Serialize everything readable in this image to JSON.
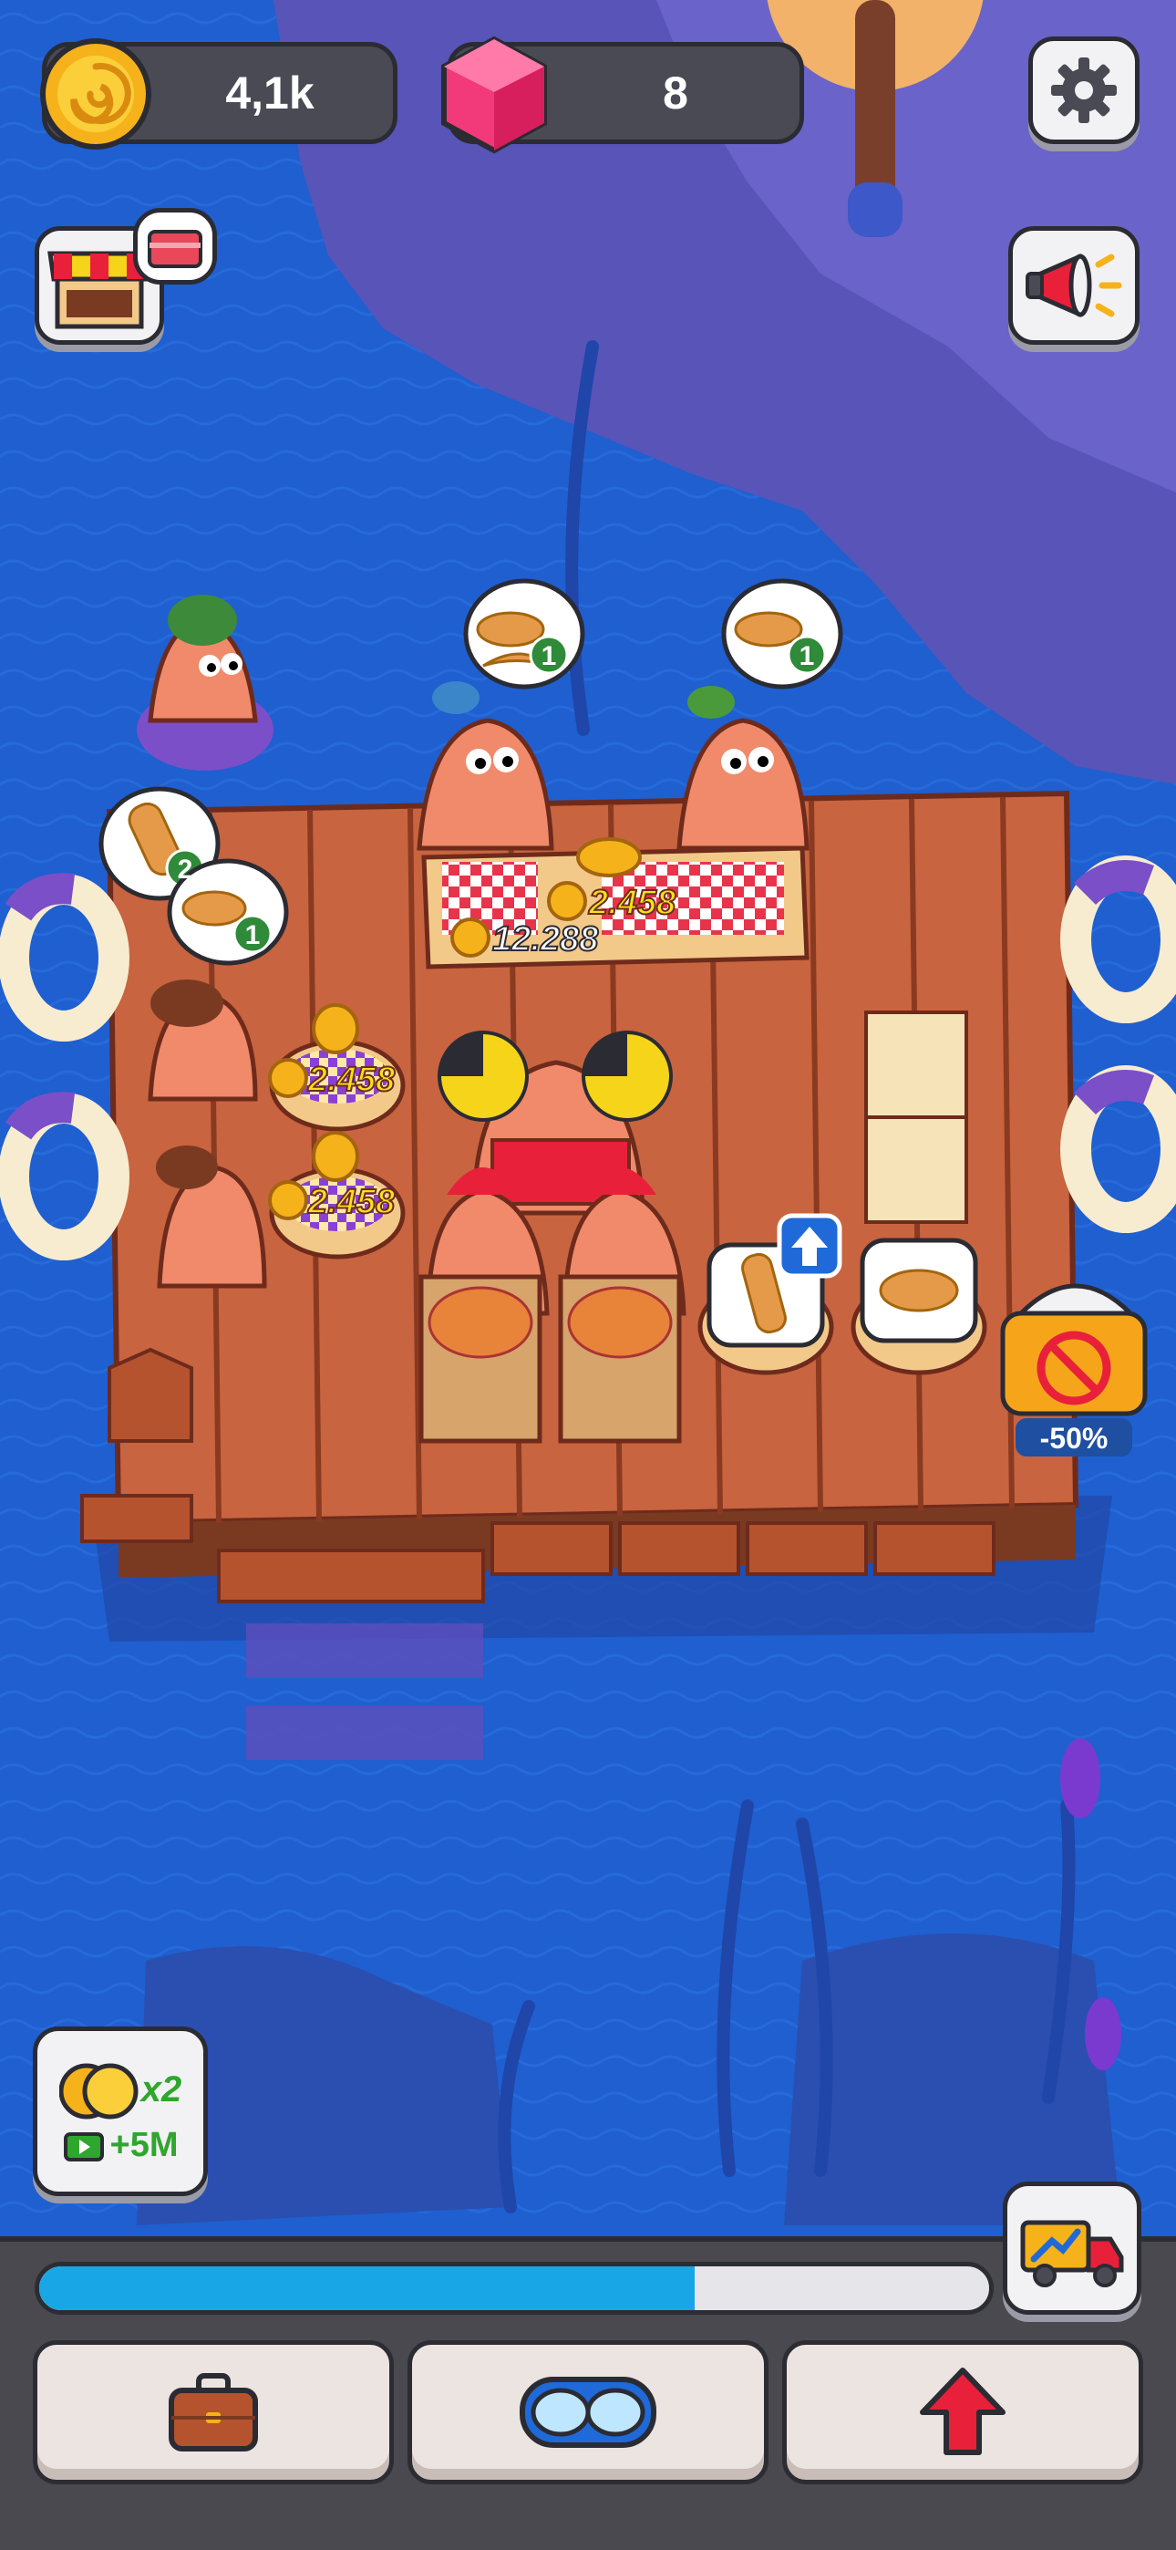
{
  "hud": {
    "coins": "4,1k",
    "gems": "8"
  },
  "orders": {
    "table_left": "1",
    "table_right": "1",
    "line_first": "2",
    "line_second": "1"
  },
  "prices": {
    "table_top": "2.458",
    "table_bottom": "12.288",
    "plate_1": "2.458",
    "plate_2": "2.458"
  },
  "ad_offer": {
    "discount": "-50%"
  },
  "boost": {
    "multiplier": "x2",
    "amount": "+5M"
  },
  "progress": {
    "fraction": 0.69
  },
  "colors": {
    "ocean": "#1f5fd0",
    "raft": "#c8643f",
    "progress_fill": "#19a6e6",
    "coin_text": "#f6e11a"
  },
  "icons": {
    "coin": "coin-icon",
    "gem": "gem-icon",
    "settings": "gear-icon",
    "shop": "shop-stall-icon",
    "megaphone": "megaphone-icon",
    "truck": "delivery-truck-icon",
    "briefcase": "briefcase-icon",
    "goggles": "diving-goggles-icon",
    "upgrade": "upgrade-arrow-icon"
  }
}
